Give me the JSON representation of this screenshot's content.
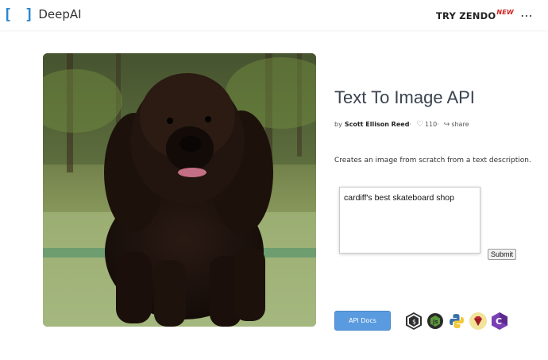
{
  "header": {
    "logo_bracket": "[ ]",
    "logo_text": "DeepAI",
    "try_zendo": "TRY ZENDO",
    "new_badge": "NEW",
    "more_icon": "⋯"
  },
  "main": {
    "image_description_icon": "dog-photo",
    "title": "Text To Image API",
    "byline_prefix": "by",
    "author": "Scott Ellison Reed",
    "byline_sep": "·",
    "likes": "110",
    "share": "share",
    "description": "Creates an image from scratch from a text description.",
    "prompt_value": "cardiff's best skateboard shop",
    "submit_label": "Submit",
    "api_docs_label": "API Docs",
    "languages": [
      "shell-icon",
      "nodejs-icon",
      "python-icon",
      "ruby-icon",
      "csharp-icon"
    ]
  },
  "colors": {
    "brand_blue": "#2b87d3",
    "new_red": "#d42020",
    "api_button": "#5a9be0"
  }
}
